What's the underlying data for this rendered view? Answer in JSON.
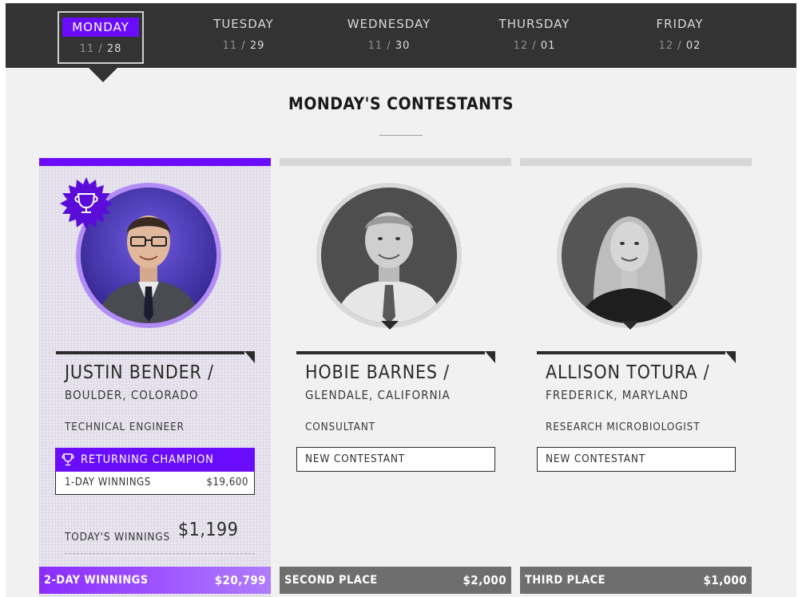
{
  "days": [
    {
      "name": "MONDAY",
      "month": "11",
      "day": "28",
      "active": true
    },
    {
      "name": "TUESDAY",
      "month": "11",
      "day": "29",
      "active": false
    },
    {
      "name": "WEDNESDAY",
      "month": "11",
      "day": "30",
      "active": false
    },
    {
      "name": "THURSDAY",
      "month": "12",
      "day": "01",
      "active": false
    },
    {
      "name": "FRIDAY",
      "month": "12",
      "day": "02",
      "active": false
    }
  ],
  "heading": "MONDAY'S CONTESTANTS",
  "colors": {
    "accent": "#6a0dff",
    "dark": "#333333",
    "footer_gray": "#6e6e6e"
  },
  "contestants": [
    {
      "name": "JUSTIN BENDER /",
      "location": "BOULDER, COLORADO",
      "occupation": "TECHNICAL ENGINEER",
      "champion_badge_icon": "trophy-icon",
      "status": "RETURNING CHAMPION",
      "prior_label": "1-DAY WINNINGS",
      "prior_value": "$19,600",
      "today_label": "TODAY'S WINNINGS",
      "today_value": "$1,199",
      "footer_label": "2-DAY WINNINGS",
      "footer_value": "$20,799"
    },
    {
      "name": "HOBIE BARNES /",
      "location": "GLENDALE, CALIFORNIA",
      "occupation": "CONSULTANT",
      "status": "NEW CONTESTANT",
      "footer_label": "SECOND PLACE",
      "footer_value": "$2,000"
    },
    {
      "name": "ALLISON TOTURA /",
      "location": "FREDERICK, MARYLAND",
      "occupation": "RESEARCH MICROBIOLOGIST",
      "status": "NEW CONTESTANT",
      "footer_label": "THIRD PLACE",
      "footer_value": "$1,000"
    }
  ]
}
